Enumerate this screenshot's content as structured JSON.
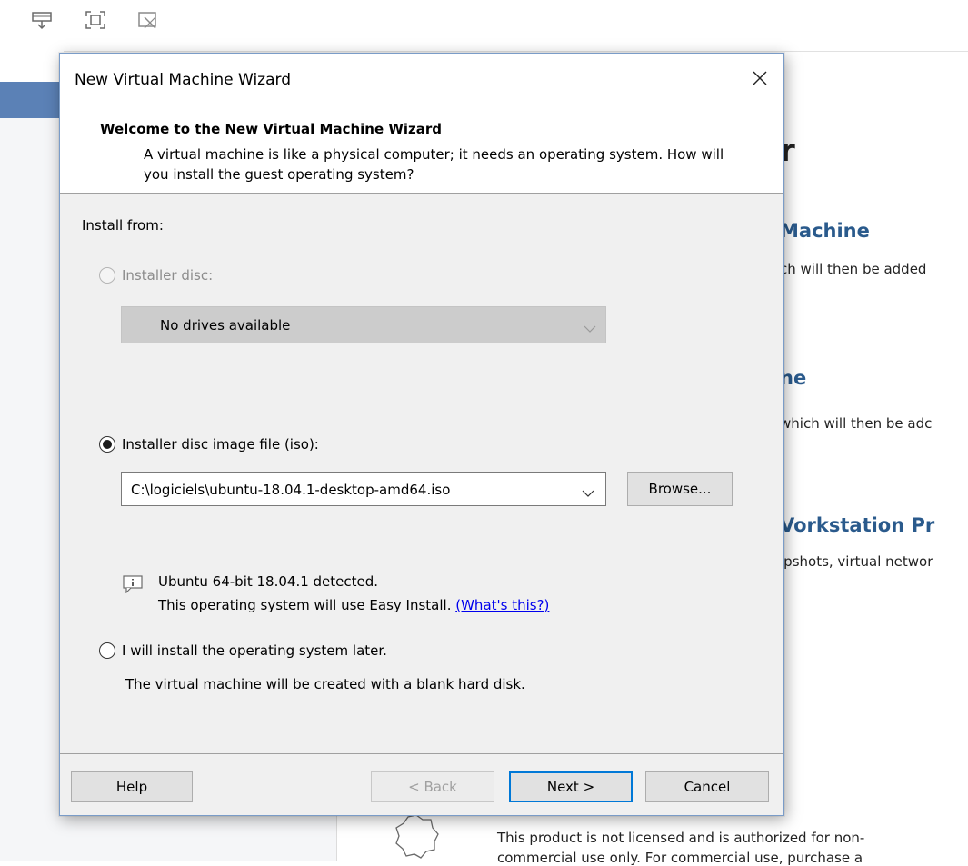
{
  "background": {
    "heading_partial_1": "r",
    "section1_title": "Machine",
    "section1_desc": "ch will then be added",
    "section2_title": "ne",
    "section2_desc": "which will then be adc",
    "section3_title": "Vorkstation Pr",
    "section3_desc": "ıpshots, virtual networ",
    "license_line1": "This product is not licensed and is authorized for non-",
    "license_line2": "commercial use only. For commercial use, purchase a"
  },
  "dialog": {
    "title": "New Virtual Machine Wizard",
    "header_title": "Welcome to the New Virtual Machine Wizard",
    "header_subtitle": "A virtual machine is like a physical computer; it needs an operating system. How will you install the guest operating system?",
    "install_from_label": "Install from:",
    "option_disc_label": "Installer disc:",
    "disc_dropdown_value": "No drives available",
    "option_iso_label": "Installer disc image file (iso):",
    "iso_path_value": "C:\\logiciels\\ubuntu-18.04.1-desktop-amd64.iso",
    "browse_label": "Browse...",
    "detected_text": "Ubuntu 64-bit 18.04.1 detected.",
    "easy_install_text": "This operating system will use Easy Install.",
    "whats_this_link": "(What's this?)",
    "option_later_label": "I will install the operating system later.",
    "later_desc": "The virtual machine will be created with a blank hard disk.",
    "selected_option": "iso"
  },
  "buttons": {
    "help": "Help",
    "back": "< Back",
    "next": "Next >",
    "cancel": "Cancel"
  },
  "colors": {
    "accent": "#0078d7",
    "link": "#0000ee",
    "bg_heading": "#2a5a8c"
  }
}
